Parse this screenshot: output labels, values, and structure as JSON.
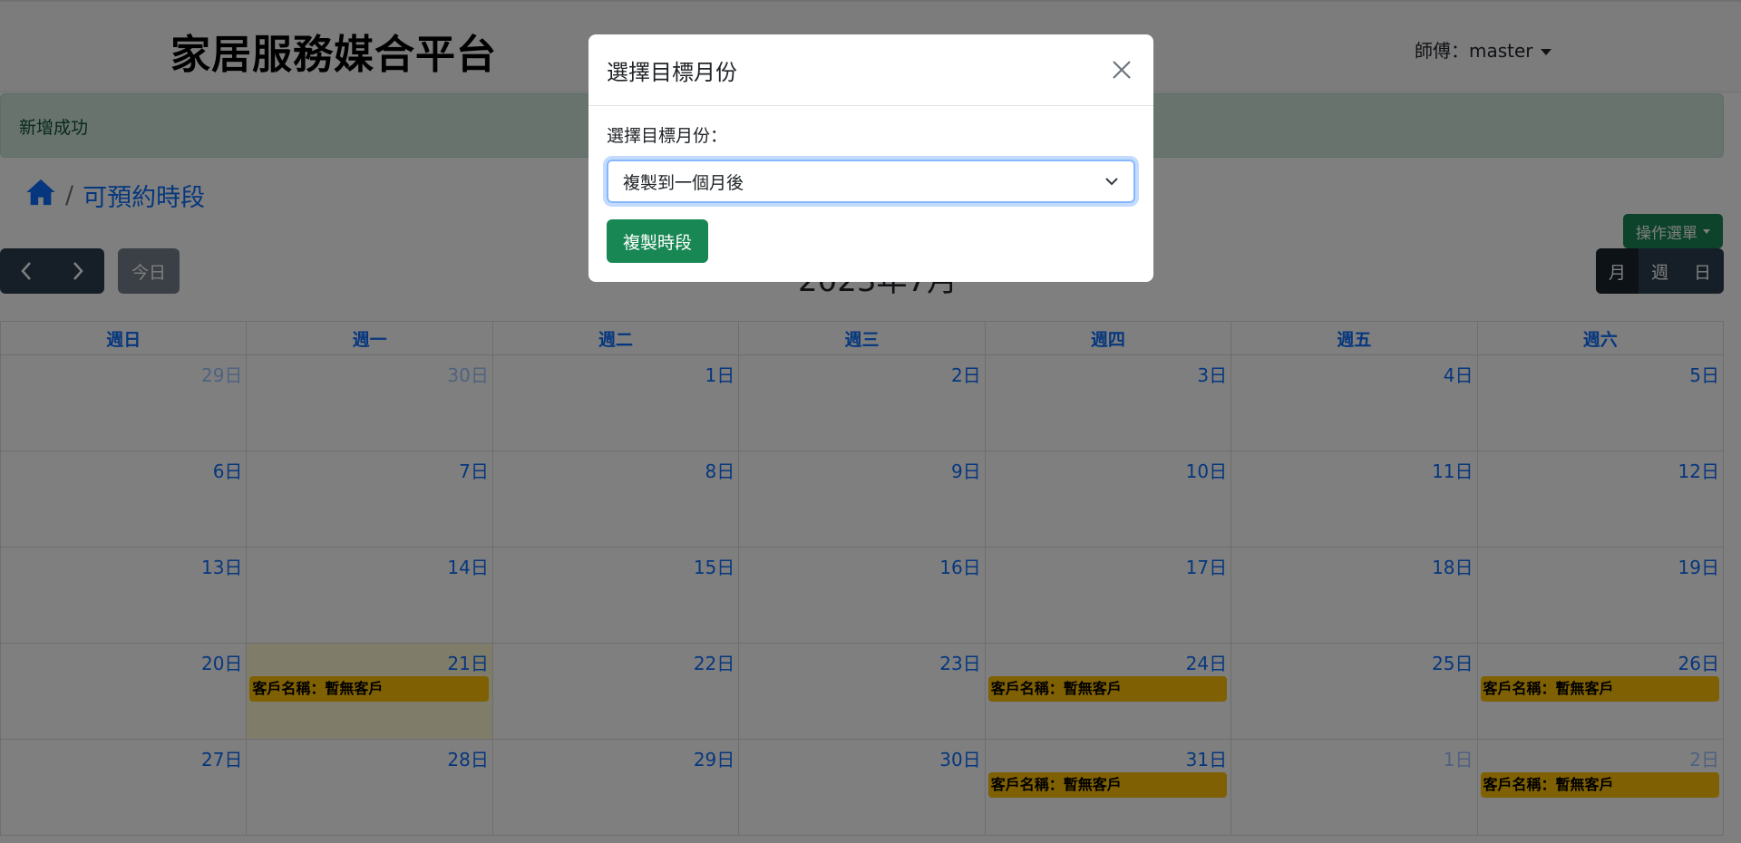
{
  "header": {
    "brand": "家居服務媒合平台",
    "user_menu": "師傅：master"
  },
  "alert": {
    "message": "新增成功"
  },
  "breadcrumb": {
    "current": "可預約時段",
    "separator": "/"
  },
  "toolbar": {
    "today": "今日",
    "title": "2023年7月",
    "ops_menu": "操作選單",
    "views": [
      "月",
      "週",
      "日"
    ],
    "active_view": "月"
  },
  "calendar": {
    "weekdays": [
      "週日",
      "週一",
      "週二",
      "週三",
      "週四",
      "週五",
      "週六"
    ],
    "weeks": [
      [
        {
          "day": "29日",
          "other": true
        },
        {
          "day": "30日",
          "other": true
        },
        {
          "day": "1日"
        },
        {
          "day": "2日"
        },
        {
          "day": "3日"
        },
        {
          "day": "4日"
        },
        {
          "day": "5日"
        }
      ],
      [
        {
          "day": "6日"
        },
        {
          "day": "7日"
        },
        {
          "day": "8日"
        },
        {
          "day": "9日"
        },
        {
          "day": "10日"
        },
        {
          "day": "11日"
        },
        {
          "day": "12日"
        }
      ],
      [
        {
          "day": "13日"
        },
        {
          "day": "14日"
        },
        {
          "day": "15日"
        },
        {
          "day": "16日"
        },
        {
          "day": "17日"
        },
        {
          "day": "18日"
        },
        {
          "day": "19日"
        }
      ],
      [
        {
          "day": "20日"
        },
        {
          "day": "21日",
          "today": true,
          "event": "客戶名稱：暫無客戶"
        },
        {
          "day": "22日"
        },
        {
          "day": "23日"
        },
        {
          "day": "24日",
          "event": "客戶名稱：暫無客戶"
        },
        {
          "day": "25日"
        },
        {
          "day": "26日",
          "event": "客戶名稱：暫無客戶"
        }
      ],
      [
        {
          "day": "27日"
        },
        {
          "day": "28日"
        },
        {
          "day": "29日"
        },
        {
          "day": "30日"
        },
        {
          "day": "31日",
          "event": "客戶名稱：暫無客戶"
        },
        {
          "day": "1日",
          "other": true
        },
        {
          "day": "2日",
          "other": true,
          "event": "客戶名稱：暫無客戶"
        }
      ]
    ]
  },
  "modal": {
    "title": "選擇目標月份",
    "label": "選擇目標月份：",
    "selected_option": "複製到一個月後",
    "submit": "複製時段"
  },
  "colors": {
    "primary": "#0d6efd",
    "success": "#198754",
    "event": "#ffc107",
    "today_bg": "#fff8d5",
    "nav_dark": "#2c3e50"
  }
}
